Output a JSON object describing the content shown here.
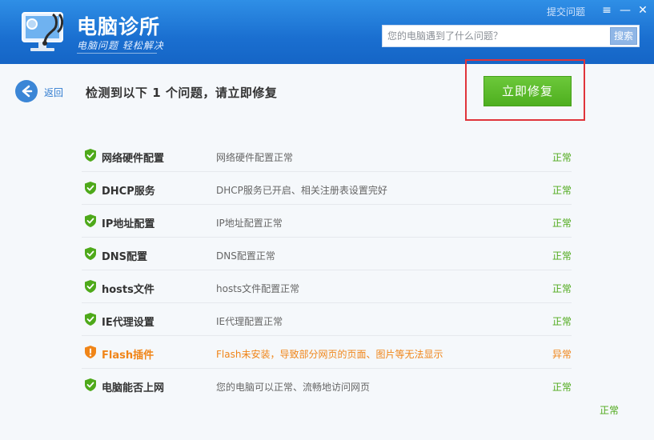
{
  "header": {
    "app_title": "电脑诊所",
    "app_slogan": "电脑问题 轻松解决",
    "feedback_label": "提交问题",
    "menu_icon": "≡",
    "minimize_icon": "—",
    "close_icon": "✕",
    "search_placeholder": "您的电脑遇到了什么问题？",
    "search_button_label": "搜索",
    "colors": {
      "header_bg": "#1f74d4"
    }
  },
  "toolbar": {
    "back_label": "返回",
    "headline": "检测到以下 1 个问题，请立即修复",
    "fix_button_label": "立即修复",
    "colors": {
      "fix_button": "#5bbb2a",
      "highlight_frame": "#e0343b"
    }
  },
  "checks": [
    {
      "name": "网络硬件配置",
      "desc": "网络硬件配置正常",
      "status": "正常",
      "icon": "shield-check-icon"
    },
    {
      "name": "DHCP服务",
      "desc": "DHCP服务已开启、相关注册表设置完好",
      "status": "正常",
      "icon": "shield-check-icon"
    },
    {
      "name": "IP地址配置",
      "desc": "IP地址配置正常",
      "status": "正常",
      "icon": "shield-check-icon"
    },
    {
      "name": "DNS配置",
      "desc": "DNS配置正常",
      "status": "正常",
      "icon": "shield-check-icon"
    },
    {
      "name": "hosts文件",
      "desc": "hosts文件配置正常",
      "status": "正常",
      "icon": "shield-check-icon"
    },
    {
      "name": "IE代理设置",
      "desc": "IE代理配置正常",
      "status": "正常",
      "icon": "shield-check-icon"
    },
    {
      "name": "Flash插件",
      "desc": "Flash未安装，导致部分网页的页面、图片等无法显示",
      "status": "异常",
      "icon": "shield-warning-icon"
    },
    {
      "name": "电脑能否上网",
      "desc": "您的电脑可以正常、流畅地访问网页",
      "status": "正常",
      "icon": "shield-check-icon"
    }
  ],
  "stray_status": "正常",
  "status_colors": {
    "ok": "#4ea91a",
    "warn": "#f08518"
  }
}
